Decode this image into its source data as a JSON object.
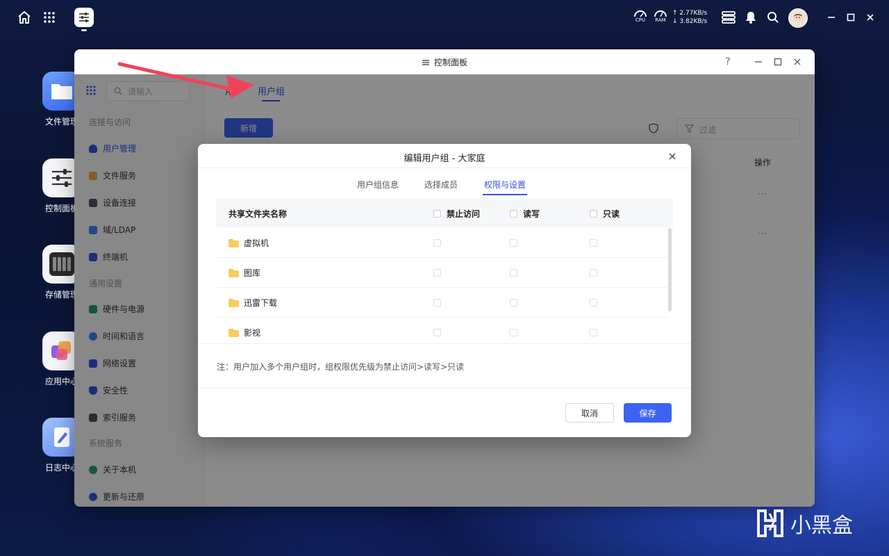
{
  "taskbar": {
    "cpu_label": "CPU",
    "ram_label": "RAM",
    "upload_speed": "↑ 2.77KB/s",
    "download_speed": "↓ 3.82KB/s"
  },
  "desktop": {
    "icons": [
      {
        "label": "文件管理"
      },
      {
        "label": "控制面板"
      },
      {
        "label": "存储管理"
      },
      {
        "label": "应用中心"
      },
      {
        "label": "日志中心"
      }
    ]
  },
  "window": {
    "title": "控制面板",
    "help": "?",
    "search_placeholder": "请输入",
    "sidebar": {
      "group1": "连接与访问",
      "group2": "通用设置",
      "group3": "系统服务",
      "items": [
        {
          "label": "用户管理"
        },
        {
          "label": "文件服务"
        },
        {
          "label": "设备连接"
        },
        {
          "label": "域/LDAP"
        },
        {
          "label": "终端机"
        },
        {
          "label": "硬件与电源"
        },
        {
          "label": "时间和语言"
        },
        {
          "label": "网络设置"
        },
        {
          "label": "安全性"
        },
        {
          "label": "索引服务"
        },
        {
          "label": "关于本机"
        },
        {
          "label": "更新与还原"
        }
      ]
    },
    "main": {
      "tab_hidden": "用",
      "tab_active": "用户组",
      "add_button": "新增",
      "filter_placeholder": "过滤",
      "col_action": "操作",
      "row_action": "···"
    }
  },
  "dialog": {
    "title": "编辑用户组 - 大家庭",
    "tabs": [
      "用户组信息",
      "选择成员",
      "权限与设置"
    ],
    "active_tab_index": 2,
    "table": {
      "headers": [
        "共享文件夹名称",
        "禁止访问",
        "读写",
        "只读"
      ],
      "rows": [
        {
          "name": "虚拟机",
          "deny": false,
          "rw": false,
          "ro": false
        },
        {
          "name": "图库",
          "deny": false,
          "rw": false,
          "ro": false
        },
        {
          "name": "迅雷下载",
          "deny": false,
          "rw": false,
          "ro": false
        },
        {
          "name": "影视",
          "deny": false,
          "rw": false,
          "ro": false
        }
      ]
    },
    "note": "注：用户加入多个用户组时，组权限优先级为禁止访问>读写>只读",
    "cancel_label": "取消",
    "save_label": "保存"
  },
  "watermark": {
    "text": "小黑盒"
  },
  "colors": {
    "accent": "#3e63f2",
    "active_text": "#3355e0",
    "annotation_arrow": "#f0435a"
  }
}
